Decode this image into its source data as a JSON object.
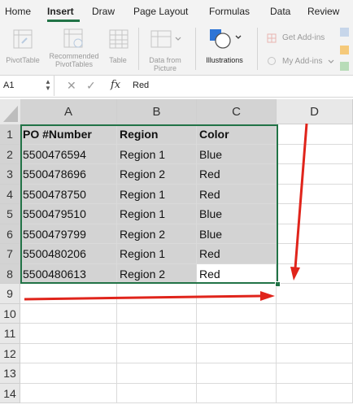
{
  "ribbon_tabs": [
    "Home",
    "Insert",
    "Draw",
    "Page Layout",
    "Formulas",
    "Data",
    "Review"
  ],
  "active_tab": "Insert",
  "ribbon": {
    "pivot_table": "PivotTable",
    "recommended_line1": "Recommended",
    "recommended_line2": "PivotTables",
    "table": "Table",
    "data_from_picture_line1": "Data from",
    "data_from_picture_line2": "Picture",
    "illustrations": "Illustrations",
    "get_addins": "Get Add-ins",
    "my_addins": "My Add-ins"
  },
  "formula_bar": {
    "name_box": "A1",
    "fx_symbol": "fx",
    "cancel": "✕",
    "enter": "✓",
    "value": "Red"
  },
  "columns": [
    "A",
    "B",
    "C",
    "D"
  ],
  "row_numbers": [
    "1",
    "2",
    "3",
    "4",
    "5",
    "6",
    "7",
    "8",
    "9",
    "10",
    "11",
    "12",
    "13",
    "14"
  ],
  "table": {
    "headers": [
      "PO #Number",
      "Region",
      "Color"
    ],
    "rows": [
      [
        "5500476594",
        "Region 1",
        "Blue"
      ],
      [
        "5500478696",
        "Region 2",
        "Red"
      ],
      [
        "5500478750",
        "Region 1",
        "Red"
      ],
      [
        "5500479510",
        "Region 1",
        "Blue"
      ],
      [
        "5500479799",
        "Region 2",
        "Blue"
      ],
      [
        "5500480206",
        "Region 1",
        "Red"
      ],
      [
        "5500480613",
        "Region 2",
        "Red"
      ]
    ]
  },
  "colors": {
    "accent_green": "#217346",
    "selection_gray": "#d3d3d3",
    "annotation_red": "#e0241b"
  }
}
